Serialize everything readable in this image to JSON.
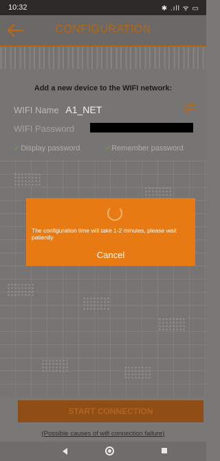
{
  "status_bar": {
    "time": "10:32",
    "icons": "✱ .ıll ᯤ ▭"
  },
  "header": {
    "title": "CONFIGURATION",
    "back_icon": "arrow-left-icon"
  },
  "form": {
    "heading": "Add a new device to the WIFI network:",
    "wifi_name_label": "WIFI Name",
    "wifi_name_value": "A1_NET",
    "wifi_password_label": "WIFI Password",
    "display_password_label": "Display password",
    "remember_password_label": "Remember password",
    "swap_icon": "swap-arrows-icon"
  },
  "dialog": {
    "message": "The configuration time will take 1-2 minutes, please wait patiently",
    "cancel_label": "Cancel"
  },
  "footer": {
    "start_label": "START CONNECTION",
    "failure_link": "(Possible causes of wifi connection failure)"
  },
  "colors": {
    "accent": "#e87a13",
    "header_text": "#b9660d",
    "start_button": "#8f4e16"
  }
}
